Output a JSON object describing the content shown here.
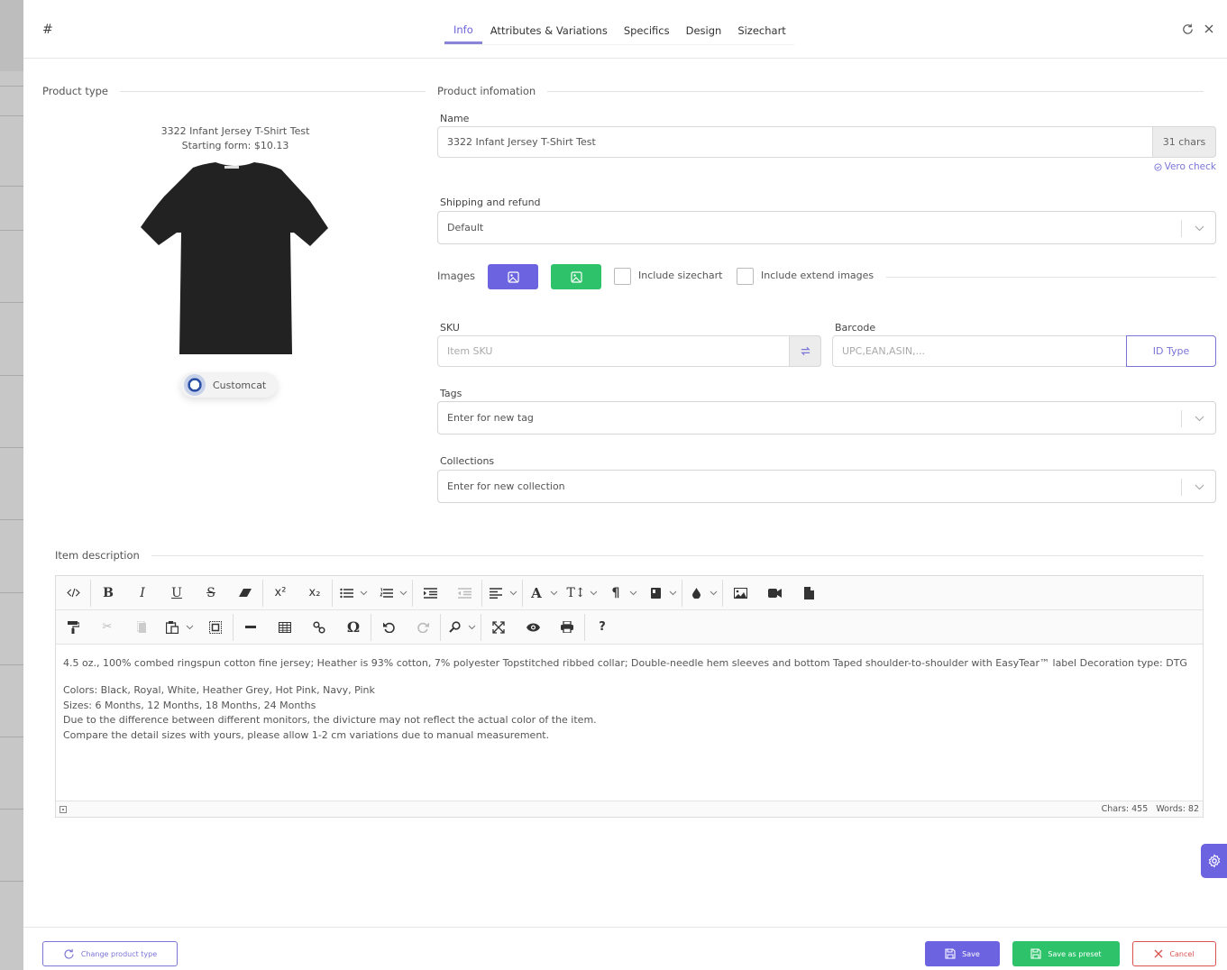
{
  "header": {
    "title": "#",
    "tabs": [
      {
        "label": "Info",
        "active": true
      },
      {
        "label": "Attributes & Variations",
        "active": false
      },
      {
        "label": "Specifics",
        "active": false
      },
      {
        "label": "Design",
        "active": false
      },
      {
        "label": "Sizechart",
        "active": false
      }
    ],
    "icons": [
      "refresh-icon",
      "close-icon"
    ]
  },
  "product_type": {
    "section_title": "Product type",
    "name": "3322 Infant Jersey T-Shirt Test",
    "starting_price": "Starting form: $10.13",
    "image": "black-t-shirt",
    "vendor": "Customcat"
  },
  "product_info": {
    "section_title": "Product infomation",
    "name_label": "Name",
    "name_value": "3322 Infant Jersey T-Shirt Test",
    "name_chars": "31 chars",
    "vero_check": "Vero check",
    "shipping_label": "Shipping and refund",
    "shipping_value": "Default",
    "images_label": "Images",
    "include_sizechart": "Include sizechart",
    "include_sizechart_checked": false,
    "include_extend": "Include extend images",
    "include_extend_checked": false,
    "sku_label": "SKU",
    "sku_placeholder": "Item SKU",
    "barcode_label": "Barcode",
    "barcode_placeholder": "UPC,EAN,ASIN,...",
    "id_type": "ID Type",
    "tags_label": "Tags",
    "tags_placeholder": "Enter for new tag",
    "collections_label": "Collections",
    "collections_placeholder": "Enter for new collection"
  },
  "description": {
    "section_title": "Item description",
    "paragraphs": [
      "4.5 oz., 100% combed ringspun cotton fine jersey; Heather is 93% cotton, 7% polyester Topstitched ribbed collar; Double-needle hem sleeves and bottom Taped shoulder-to-shoulder with EasyTear™ label Decoration type: DTG",
      "",
      "Colors: Black, Royal, White, Heather Grey, Hot Pink, Navy, Pink",
      "Sizes: 6 Months, 12 Months, 18 Months, 24 Months",
      "Due to the difference between different monitors, the divicture may not reflect the actual color of the item.",
      "Compare the detail sizes with yours, please allow 1-2 cm variations due to manual measurement."
    ],
    "status": "Chars: 455   Words: 82"
  },
  "footer": {
    "change_type": "Change product type",
    "save": "Save",
    "save_preset": "Save as preset",
    "cancel": "Cancel"
  },
  "colors": {
    "accent": "#6c63e0",
    "green": "#2ec36b",
    "danger": "#d9534f"
  }
}
